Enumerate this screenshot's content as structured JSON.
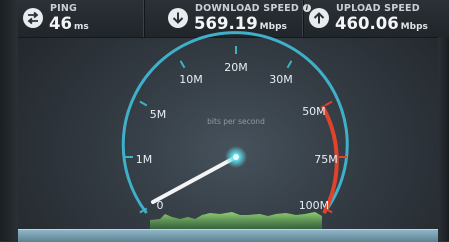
{
  "ping": {
    "label": "PING",
    "value": "46",
    "unit": "ms",
    "icon": "ping-arrows-icon"
  },
  "download": {
    "label": "DOWNLOAD SPEED",
    "value": "569.19",
    "unit": "Mbps",
    "icon": "download-arrow-icon",
    "info": "i"
  },
  "upload": {
    "label": "UPLOAD SPEED",
    "value": "460.06",
    "unit": "Mbps",
    "icon": "upload-arrow-icon"
  },
  "gauge": {
    "center_label": "bits per second",
    "ticks": [
      "0",
      "1M",
      "5M",
      "10M",
      "20M",
      "30M",
      "50M",
      "75M",
      "100M"
    ],
    "needle_value_label": "0",
    "colors": {
      "arc": "#3fb0c9",
      "redline": "#e0432a",
      "needle": "#f2f4f5",
      "hub": "#5fe1ee",
      "graph": "#8fd66a"
    }
  }
}
